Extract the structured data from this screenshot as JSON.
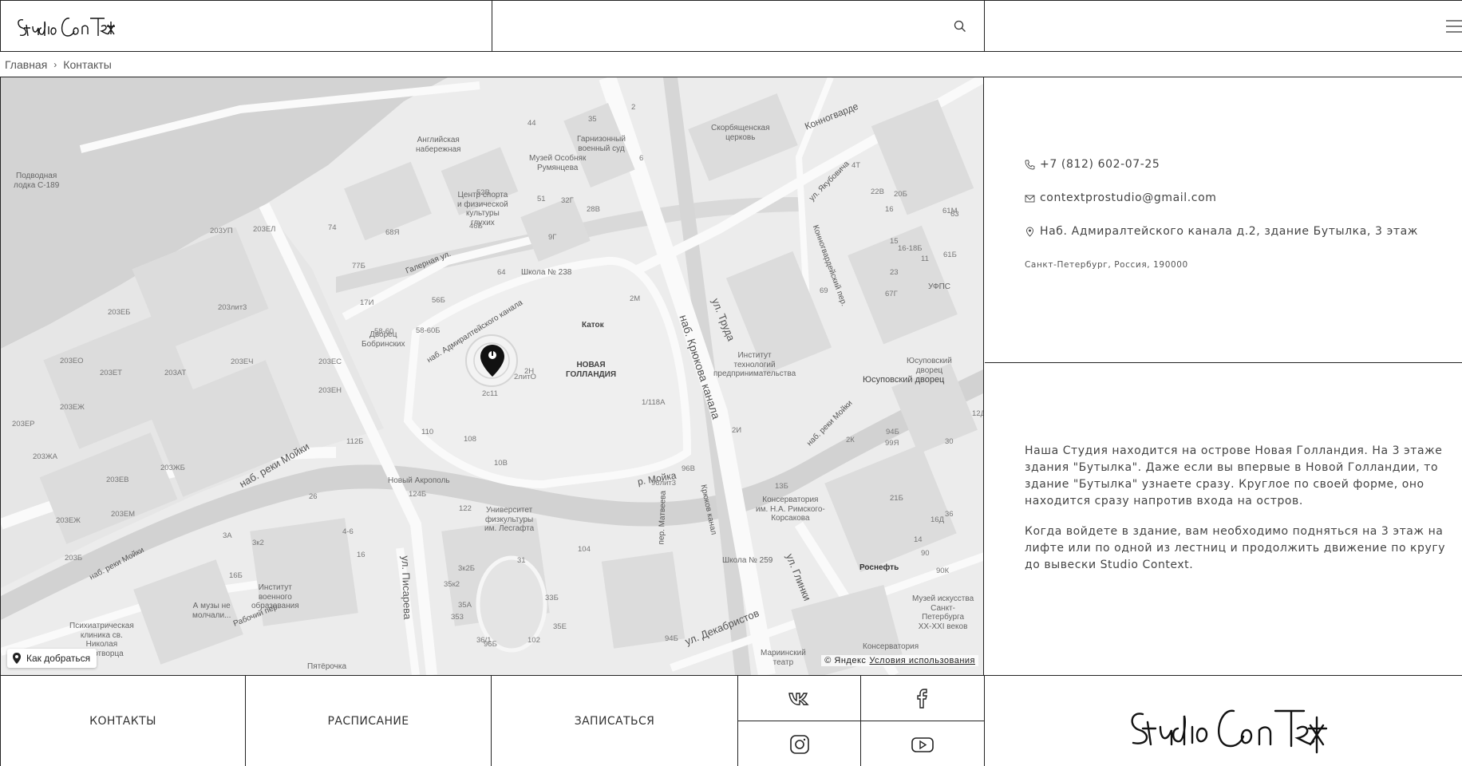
{
  "header": {
    "logo_text": "Studio Context",
    "search_icon": "search-icon",
    "menu_icon": "burger-menu-icon"
  },
  "breadcrumb": {
    "home": "Главная",
    "separator": "›",
    "current": "Контакты"
  },
  "map": {
    "route_button": "Как добраться",
    "copyright": "© Яндекс",
    "terms": "Условия использования",
    "labels": {
      "podlodka": "Подводная\nлодка С-189",
      "english_emb": "Английская\nнабережная",
      "rumyantsev": "Музей Особняк\nРумянцева",
      "garrison": "Гарнизонный\nвоенный суд",
      "skorb": "Скорбященская\nцерковь",
      "center_sport": "Центр спорта\nи физической\nкультуры\nглухих",
      "school238": "Школа № 238",
      "bobrinsky": "Дворец\nБобринских",
      "katok": "Каток",
      "new_holland": "НОВАЯ\nГОЛЛАНДИЯ",
      "institute_tech": "Институт\nтехнологий\nпредпринимательства",
      "yusupov1": "Юсуповский\nдворец",
      "yusupov2": "Юсуповский дворец",
      "ufps": "УФПС",
      "new_acropolis": "Новый Акрополь",
      "lesgaft": "Университет\nфизкультуры\nим. Лесгафта",
      "rimsky": "Консерватория\nим. Н.А. Римского-\nКорсакова",
      "rosneft": "Роснефть",
      "school259": "Школа № 259",
      "museum_art": "Музей искусства\nСанкт-\nПетербурга\nXX-XXI веков",
      "konserv": "Консерватория",
      "mariinsky": "Мариинский\nтеатр",
      "inst_military": "Институт\nвоенного\nобразования",
      "amuzy": "А музы не\nмолчали...",
      "psych": "Психиатрическая\nклиника св.\nНиколая\nЧудотворца",
      "pyaterochka": "Пятёрочка"
    },
    "streets": {
      "galernaya": "Галерная ул.",
      "admiralteysky": "наб. Адмиралтейского канала",
      "kryukova": "наб. Крюкова канала",
      "truda": "ул. Труда",
      "yakubovicha": "ул. Якубовича",
      "konnogvard": "Конногвардейский пер.",
      "konnogvard_top": "Конногварде",
      "moyki1": "наб. реки Мойки",
      "moyki2": "наб. реки Мойки",
      "moyki3": "наб. реки Мойки",
      "moyka": "р. Мойка",
      "kryukov_kanal": "Крюков канал",
      "pisareva": "ул. Писарева",
      "matveeva": "пер. Матвеева",
      "glinki": "ул. Глинки",
      "dekabristov": "ул. Декабристов",
      "rabochiy": "Рабочий пер."
    },
    "houses": [
      "203УП",
      "203ЕЛ",
      "203лит3",
      "203ЕБ",
      "203ЕО",
      "203ЕТ",
      "203АТ",
      "203ЕЖ",
      "203ЕЧ",
      "203ЕР",
      "203ЖА",
      "203ЖБ",
      "203ЕВ",
      "203ЕМ",
      "203ЕЖ",
      "203Б",
      "203ЕС",
      "203ЕН",
      "74",
      "68Я",
      "77Б",
      "64",
      "46Б",
      "17И",
      "58-60",
      "58-60Б",
      "56Б",
      "52В",
      "51",
      "32Г",
      "28В",
      "9Г",
      "44",
      "35",
      "2",
      "6",
      "4Т",
      "22В",
      "20Б",
      "16",
      "15",
      "11",
      "61Б",
      "16-18Б",
      "61М",
      "23",
      "63",
      "67Г",
      "69",
      "2И",
      "2М",
      "2Н",
      "2с11",
      "2литО",
      "1/118А",
      "112Б",
      "110",
      "108",
      "10В",
      "122",
      "124Б",
      "26",
      "4-6",
      "3А",
      "3к2",
      "16",
      "16Б",
      "35к2",
      "35А",
      "3к2Б",
      "353",
      "35Е",
      "33Б",
      "31",
      "104",
      "102",
      "36/1",
      "96Б",
      "94Б",
      "96лит3",
      "96В",
      "94Б",
      "99Я",
      "30",
      "2К",
      "21Б",
      "36",
      "90",
      "90К",
      "14",
      "16Д",
      "13Б",
      "12Д"
    ],
    "pin_icon": "location-pin-icon"
  },
  "contact": {
    "phone": "+7 (812) 602-07-25",
    "email": "contextprostudio@gmail.com",
    "address": "Наб. Адмиралтейского канала д.2, здание Бутылка, 3 этаж",
    "city": "Санкт-Петербург, Россия, 190000"
  },
  "description": {
    "p1": "Наша Студия находится на острове Новая Голландия. На 3 этаже здания \"Бутылка\". Даже если вы впервые в Новой Голландии, то здание \"Бутылка\" узнаете сразу. Круглое по своей форме, оно находится сразу напротив входа на остров.",
    "p2": "Когда войдете в здание, вам необходимо подняться на 3 этаж на лифте или по одной из лестниц и продолжить движение по кругу до вывески Studio Context."
  },
  "footer": {
    "contacts": "КОНТАКТЫ",
    "schedule": "РАСПИСАНИЕ",
    "signup": "ЗАПИСАТЬСЯ",
    "socials": [
      "vk-icon",
      "facebook-icon",
      "instagram-icon",
      "youtube-icon"
    ],
    "logo_text": "Studio Context"
  }
}
